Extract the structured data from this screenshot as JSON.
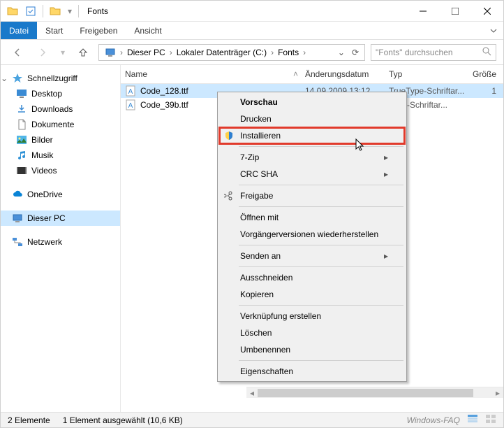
{
  "window": {
    "title": "Fonts"
  },
  "ribbon": {
    "file": "Datei",
    "tabs": [
      "Start",
      "Freigeben",
      "Ansicht"
    ]
  },
  "breadcrumb": {
    "segments": [
      "Dieser PC",
      "Lokaler Datenträger (C:)",
      "Fonts"
    ]
  },
  "search": {
    "placeholder": "\"Fonts\" durchsuchen"
  },
  "sidebar": {
    "quick_access": "Schnellzugriff",
    "items": [
      "Desktop",
      "Downloads",
      "Dokumente",
      "Bilder",
      "Musik",
      "Videos"
    ],
    "onedrive": "OneDrive",
    "this_pc": "Dieser PC",
    "network": "Netzwerk"
  },
  "columns": {
    "name": "Name",
    "date": "Änderungsdatum",
    "type": "Typ",
    "size": "Größe"
  },
  "files": [
    {
      "name": "Code_128.ttf",
      "date": "14.09.2009 13:12",
      "type": "TrueType-Schriftar...",
      "selected": true
    },
    {
      "name": "Code_39b.ttf",
      "date": "",
      "type": "Type-Schriftar...",
      "selected": false
    }
  ],
  "context_menu": {
    "preview": "Vorschau",
    "print": "Drucken",
    "install": "Installieren",
    "sevenzip": "7-Zip",
    "crcsha": "CRC SHA",
    "share": "Freigabe",
    "open_with": "Öffnen mit",
    "restore_versions": "Vorgängerversionen wiederherstellen",
    "send_to": "Senden an",
    "cut": "Ausschneiden",
    "copy": "Kopieren",
    "create_shortcut": "Verknüpfung erstellen",
    "delete": "Löschen",
    "rename": "Umbenennen",
    "properties": "Eigenschaften"
  },
  "status": {
    "count": "2 Elemente",
    "selection": "1 Element ausgewählt (10,6 KB)",
    "watermark": "Windows-FAQ"
  }
}
